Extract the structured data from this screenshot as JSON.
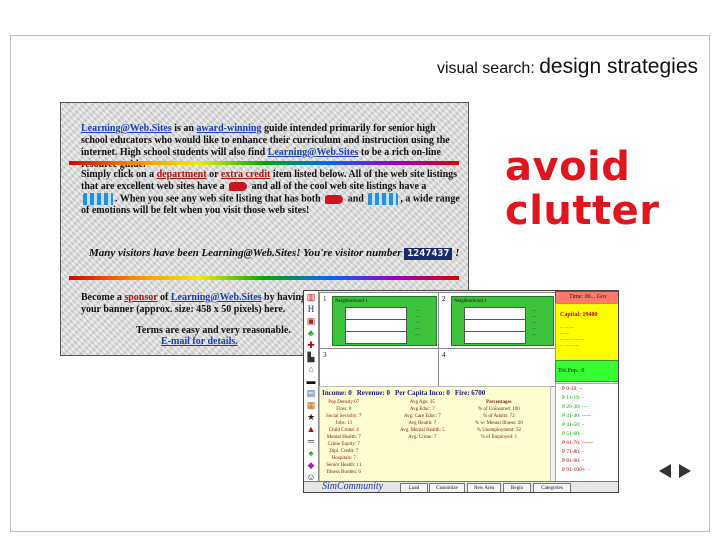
{
  "slide": {
    "title_small": "visual search:",
    "title_big": "design strategies",
    "callout": [
      "avoid",
      "clutter"
    ]
  },
  "website": {
    "intro": [
      "Learning@Web.Sites",
      " is an ",
      "award-winning",
      " guide intended primarily for senior high school educators who would like to enhance their curriculum and instruction using the internet. High school students will also find ",
      "Learning@Web.Sites",
      " to be a rich on-line resource guide."
    ],
    "click_line": [
      "Simply click on a ",
      "department",
      " or ",
      "extra credit",
      " item listed below. All of the web site listings that are excellent web sites have a ",
      " and all of the cool web site listings have a ",
      ". When you see any web site listing that has both ",
      " and ",
      ", a wide range of emotions will be felt when you visit those web sites!"
    ],
    "visitors_text": "Many visitors have been Learning@Web.Sites! You're visitor number",
    "visitor_count": "1247437",
    "visitors_end": "!",
    "sponsor": [
      "Become a ",
      "sponsor",
      " of ",
      "Learning@Web.Sites",
      " by having your banner (approx. size: 458 x 50 pixels) here."
    ],
    "terms": "Terms are easy and very reasonable.",
    "email": "E-mail for details."
  },
  "sim": {
    "quadrants": [
      "1",
      "2",
      "3",
      "4"
    ],
    "green_header": "Neighborhood 1",
    "stats_header": [
      "Income: 0",
      "Revenue: 0",
      "Per Capita Inco: 0",
      "Fire: 6700"
    ],
    "col1": [
      "Pop Density:67",
      "Fires: 0",
      "Social Security: 7",
      "Jobs: 13",
      "Child Crime: 4",
      "Mental Health: 7",
      "Crime Equity: 7",
      "Dipl. Credit: 7",
      "Hospitals: 7",
      "Senior Health: 11",
      "Illness Burden: 6"
    ],
    "col2": [
      "Avg Age: 35",
      "Avg Educ: 7",
      "Avg. Care Educ: 7",
      "Avg Health: 7",
      "Avg. Mental Health: 5",
      "Avg. Crime: 7"
    ],
    "col3": [
      "Percentages",
      "% of Uninsured: 100",
      "% of Adults: 72",
      "% w/ Mental Illness: 20",
      "% Unemployment: 52",
      "% of Employed: 1"
    ],
    "side_red": "Time: 00... Gov",
    "capital": "Capital: 19400",
    "green_side": "Tot.Pop.: 0",
    "age_rows": [
      "P 0-10: --",
      "P 11-19: -",
      "P 20-30: ---",
      "P 31-40: -----",
      "P 41-50: -",
      "P 51-60: -",
      "P 61-70: ------",
      "P 71-80: -",
      "P 81-90: -",
      "P 91-100+: -"
    ],
    "logo": "SimCommunity",
    "buttons": [
      "Load",
      "Customize",
      "New Area",
      "Begin",
      "Categories"
    ]
  }
}
